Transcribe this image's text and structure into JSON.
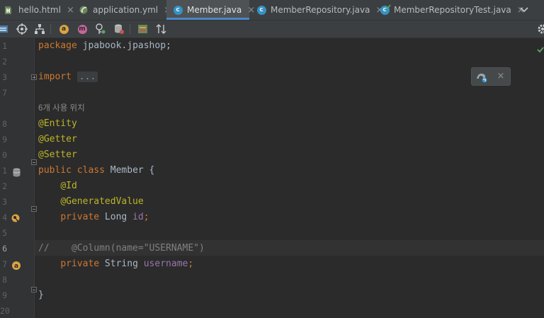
{
  "tabs": [
    {
      "label": "hello.html",
      "icon": "html-file-icon",
      "active": false
    },
    {
      "label": "application.yml",
      "icon": "yaml-file-icon",
      "active": false
    },
    {
      "label": "Member.java",
      "icon": "java-class-icon",
      "active": true
    },
    {
      "label": "MemberRepository.java",
      "icon": "java-class-icon",
      "active": false
    },
    {
      "label": "MemberRepositoryTest.java",
      "icon": "java-test-class-icon",
      "active": false
    }
  ],
  "tab_close_glyph": "×",
  "class_icon_letter": "c",
  "toolbar": {
    "items": [
      "db-icon",
      "target-icon",
      "hierarchy-icon",
      "autowired-icon",
      "method-icon",
      "bean-icon",
      "database-search-icon",
      "spring-bean-icon",
      "sort-icon"
    ],
    "letters": {
      "autowired": "a",
      "method": "m"
    }
  },
  "editor": {
    "line_numbers": [
      "1",
      "2",
      "3",
      "7",
      "8",
      "9",
      "0",
      "1",
      "2",
      "3",
      "4",
      "5",
      "6",
      "7",
      "8",
      "9",
      "20"
    ],
    "current_line_number": "6",
    "usage_hint": "6개 사용 위치",
    "code": {
      "package_kw": "package",
      "package_name": " jpabook.jpashop;",
      "import_kw": "import",
      "import_folded": "...",
      "entity": "@Entity",
      "getter": "@Getter",
      "setter": "@Setter",
      "public_kw": "public",
      "class_kw": "class",
      "class_name": " Member {",
      "id_ann": "@Id",
      "generated_ann": "@GeneratedValue",
      "private_kw": "private",
      "long_type": " Long ",
      "id_field": "id",
      "semicolon": ";",
      "comment": "//    @Column(name=\"USERNAME\")",
      "string_type": " String ",
      "username_field": "username",
      "close_brace": "}"
    }
  },
  "popup": {
    "close_glyph": "×"
  },
  "colors": {
    "keyword": "#cc7832",
    "annotation": "#bbb529",
    "field": "#9876aa",
    "comment": "#808080",
    "tab_underline": "#4a88c7"
  }
}
